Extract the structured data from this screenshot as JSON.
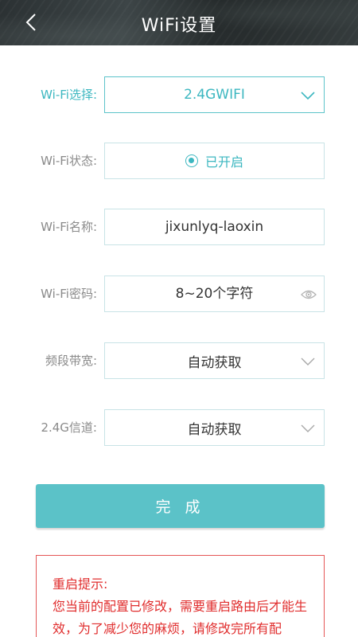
{
  "header": {
    "title": "WiFi设置",
    "back_icon": "chevron-left-icon"
  },
  "form": {
    "wifi_select": {
      "label": "Wi-Fi选择:",
      "value": "2.4GWIFI"
    },
    "wifi_status": {
      "label": "Wi-Fi状态:",
      "value": "已开启",
      "checked": true
    },
    "wifi_name": {
      "label": "Wi-Fi名称:",
      "value": "jixunlyq-laoxin"
    },
    "wifi_password": {
      "label": "Wi-Fi密码:",
      "placeholder": "8~20个字符"
    },
    "bandwidth": {
      "label": "频段带宽:",
      "value": "自动获取"
    },
    "channel": {
      "label": "2.4G信道:",
      "value": "自动获取"
    }
  },
  "done_button": {
    "label": "完 成"
  },
  "notice": {
    "title": "重启提示:",
    "text": "您当前的配置已修改，需要重启路由后才能生效，为了减少您的麻烦，请修改完所有配"
  },
  "colors": {
    "accent": "#3cb7c0",
    "button": "#5bc2c8",
    "warning": "#e02d2d",
    "label": "#8a8a8a",
    "header_bg": "#2b3133"
  }
}
